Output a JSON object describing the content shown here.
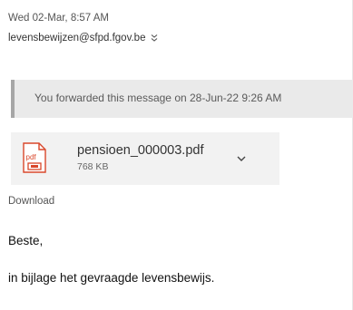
{
  "header": {
    "date": "Wed 02-Mar, 8:57 AM",
    "sender": "levensbewijzen@sfpd.fgov.be",
    "expand_icon": "chevron-double-down-icon"
  },
  "forward_notice": {
    "text": "You forwarded this message on 28-Jun-22 9:26 AM"
  },
  "attachment": {
    "icon": "pdf-file-icon",
    "icon_label": "pdf",
    "name": "pensioen_000003.pdf",
    "size": "768 KB",
    "menu_icon": "chevron-down-icon"
  },
  "download": {
    "label": "Download"
  },
  "message": {
    "greeting": "Beste,",
    "line1": "in bijlage het gevraagde levensbewijs."
  },
  "colors": {
    "banner_bg": "#eaeaea",
    "banner_bar": "#a6a6a6",
    "attachment_bg": "#f2f2f2",
    "pdf_red": "#d9472b"
  }
}
